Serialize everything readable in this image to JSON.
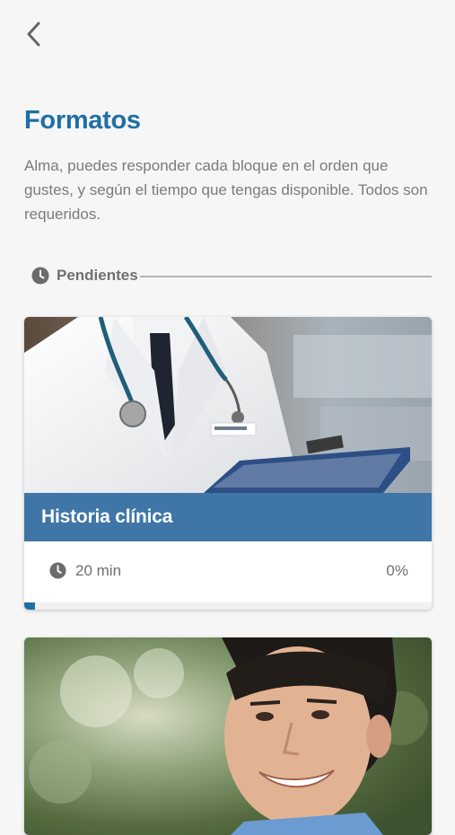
{
  "header": {
    "back_icon": "chevron-left-icon"
  },
  "page": {
    "title": "Formatos",
    "intro": "Alma, puedes responder cada bloque en el orden que gustes, y según el tiempo que tengas disponible. Todos son requeridos."
  },
  "section": {
    "label": "Pendientes",
    "icon": "clock-icon"
  },
  "cards": [
    {
      "title": "Historia clínica",
      "duration": "20 min",
      "progress_label": "0%",
      "progress_value": 0,
      "image": "doctor-with-stethoscope-and-clipboard"
    },
    {
      "image": "smiling-young-man-outdoors"
    }
  ],
  "colors": {
    "accent": "#1e6fa6",
    "banner": "#3f76a7",
    "text_muted": "#7b7b7b",
    "background": "#f6f6f6"
  }
}
